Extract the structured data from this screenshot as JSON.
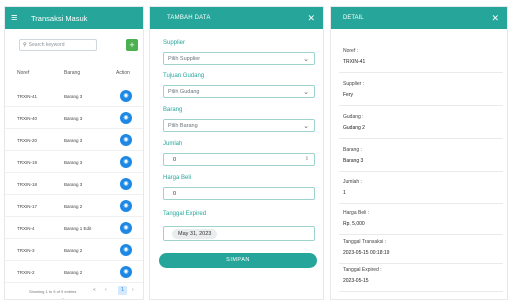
{
  "list": {
    "title": "Transaksi Masuk",
    "search_placeholder": "Search keyword",
    "headers": {
      "noref": "Noref",
      "barang": "Barang",
      "action": "Action"
    },
    "rows": [
      {
        "noref": "TRXIN-41",
        "barang": "Barang 3"
      },
      {
        "noref": "TRXIN-40",
        "barang": "Barang 3"
      },
      {
        "noref": "TRXIN-20",
        "barang": "Barang 3"
      },
      {
        "noref": "TRXIN-19",
        "barang": "Barang 3"
      },
      {
        "noref": "TRXIN-18",
        "barang": "Barang 3"
      },
      {
        "noref": "TRXIN-17",
        "barang": "Barang 2"
      },
      {
        "noref": "TRXIN-4",
        "barang": "Barang 1 Edit"
      },
      {
        "noref": "TRXIN-3",
        "barang": "Barang 2"
      },
      {
        "noref": "TRXIN-2",
        "barang": "Barang 2"
      }
    ],
    "footer": "Showing 1 to 9 of 9 entries",
    "page": "1"
  },
  "form": {
    "title": "TAMBAH DATA",
    "supplier_label": "Supplier",
    "supplier_value": "Pilih Supplier",
    "gudang_label": "Tujuan Gudang",
    "gudang_value": "Pilih Gudang",
    "barang_label": "Barang",
    "barang_value": "Pilih Barang",
    "jumlah_label": "Jumlah",
    "jumlah_value": "0",
    "harga_label": "Harga Beli",
    "harga_value": "0",
    "expired_label": "Tanggal Expired",
    "expired_value": "May 31, 2023",
    "save": "SIMPAN"
  },
  "detail": {
    "title": "DETAIL",
    "noref_label": "Noref :",
    "noref": "TRXIN-41",
    "supplier_label": "Supplier :",
    "supplier": "Fery",
    "gudang_label": "Gudang :",
    "gudang": "Gudang 2",
    "barang_label": "Barang :",
    "barang": "Barang 3",
    "jumlah_label": "Jumlah :",
    "jumlah": "1",
    "harga_label": "Harga Beli :",
    "harga": "Rp. 5,000",
    "tgl_transaksi_label": "Tanggal Transaksi :",
    "tgl_transaksi": "2023-05-15 00:18:19",
    "tgl_expired_label": "Tanggal Expired :",
    "tgl_expired": "2023-05-15"
  },
  "colors": {
    "primary": "#26a69a",
    "action": "#1e88e5",
    "add": "#4caf50"
  }
}
